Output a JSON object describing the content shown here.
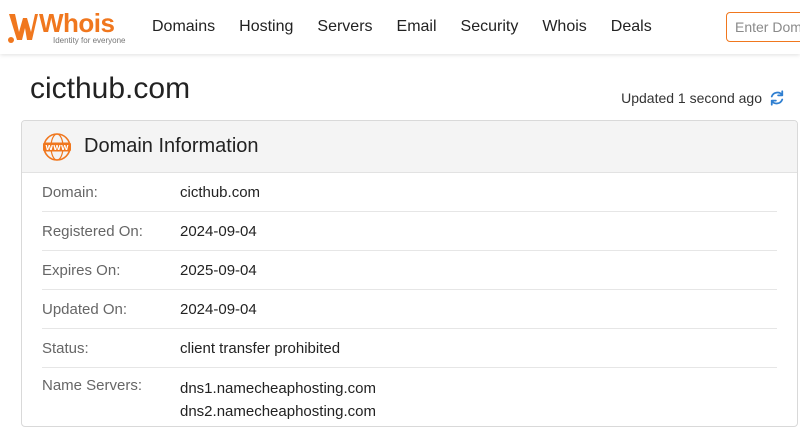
{
  "header": {
    "logo_word": "Whois",
    "logo_tagline": "Identity for everyone",
    "nav": [
      "Domains",
      "Hosting",
      "Servers",
      "Email",
      "Security",
      "Whois",
      "Deals"
    ],
    "search_placeholder": "Enter Domain"
  },
  "page": {
    "title": "cicthub.com",
    "updated_text": "Updated 1 second ago"
  },
  "card": {
    "title": "Domain Information",
    "rows": [
      {
        "label": "Domain:",
        "value": "cicthub.com"
      },
      {
        "label": "Registered On:",
        "value": "2024-09-04"
      },
      {
        "label": "Expires On:",
        "value": "2025-09-04"
      },
      {
        "label": "Updated On:",
        "value": "2024-09-04"
      },
      {
        "label": "Status:",
        "value": "client transfer prohibited"
      }
    ],
    "name_servers_label": "Name Servers:",
    "name_servers": [
      "dns1.namecheaphosting.com",
      "dns2.namecheaphosting.com"
    ]
  },
  "colors": {
    "brand": "#f0771e",
    "refresh": "#2f7fd1"
  },
  "icons": {
    "logo": "whois-logo-icon",
    "refresh": "refresh-icon",
    "domain": "www-icon"
  }
}
